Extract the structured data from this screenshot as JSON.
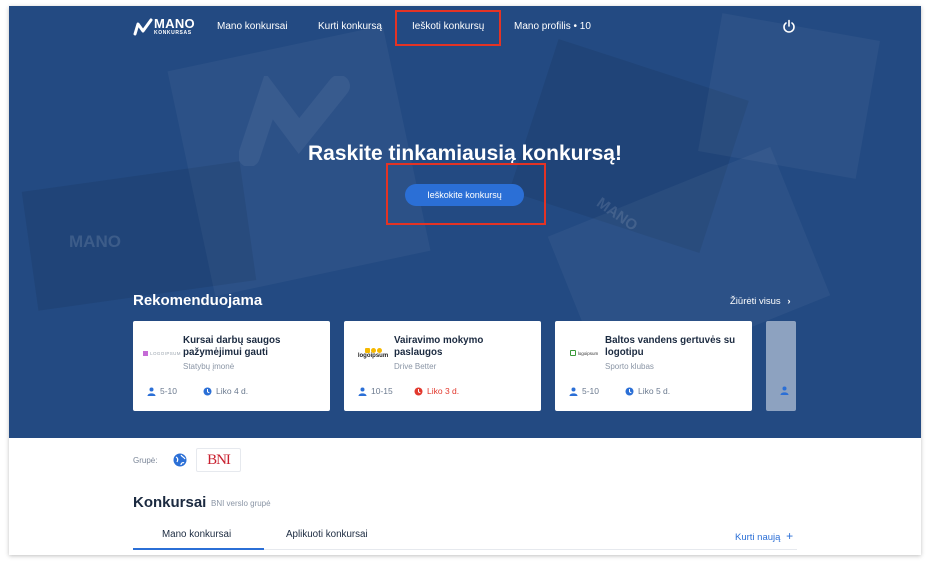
{
  "nav": {
    "logo_main": "MANO",
    "logo_sub": "KONKURSAS",
    "items": [
      {
        "label": "Mano konkursai"
      },
      {
        "label": "Kurti konkursą"
      },
      {
        "label": "Ieškoti konkursų"
      },
      {
        "label": "Mano profilis"
      }
    ],
    "profile_count": "• 10",
    "power_icon": "power-icon"
  },
  "hero": {
    "title": "Raskite tinkamiausią konkursą!",
    "cta_label": "Ieškokite konkursų",
    "watermark": "MANO"
  },
  "recommend": {
    "title": "Rekomenduojama",
    "see_all": "Žiūrėti visus",
    "cards": [
      {
        "logo": "LOGOIPSUM",
        "title": "Kursai darbų saugos pažymėjimui gauti",
        "subtitle": "Statybų įmonė",
        "participants": "5-10",
        "deadline": "Liko 4 d.",
        "deadline_urgent": false
      },
      {
        "logo": "logoipsum",
        "title": "Vairavimo mokymo paslaugos",
        "subtitle": "Drive Better",
        "participants": "10-15",
        "deadline": "Liko 3 d.",
        "deadline_urgent": true
      },
      {
        "logo": "logoipsum",
        "title": "Baltos vandens gertuvės su logotipu",
        "subtitle": "Sporto klubas",
        "participants": "5-10",
        "deadline": "Liko 5 d.",
        "deadline_urgent": false
      }
    ]
  },
  "group": {
    "label": "Grupė:",
    "badge": "BNI"
  },
  "contests": {
    "title": "Konkursai",
    "subtitle": "BNI verslo grupė",
    "tabs": [
      {
        "label": "Mano konkursai",
        "active": true
      },
      {
        "label": "Aplikuoti konkursai",
        "active": false
      }
    ],
    "new_label": "Kurti naują",
    "new_icon": "+"
  },
  "colors": {
    "hero_bg": "#234a82",
    "accent": "#2b6fd6",
    "highlight": "#e43324",
    "urgent": "#e2382d"
  }
}
